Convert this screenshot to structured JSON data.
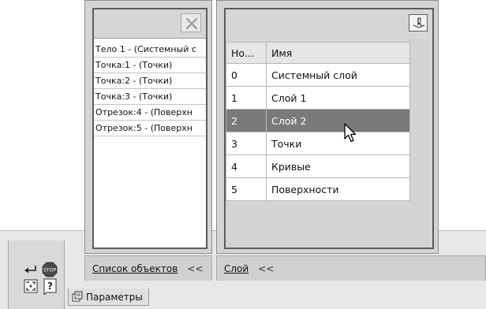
{
  "objects_panel": {
    "items": [
      "Тело 1 - (Системный с",
      "Точка:1 - (Точки)",
      "Точка:2 - (Точки)",
      "Точка:3 - (Точки)",
      "Отрезок:4 - (Поверхн",
      "Отрезок:5 - (Поверхн"
    ],
    "tab_label": "Список объектов",
    "collapse": "<<"
  },
  "layers_panel": {
    "columns": [
      "Но...",
      "Имя"
    ],
    "rows": [
      {
        "num": "0",
        "name": "Системный слой"
      },
      {
        "num": "1",
        "name": "Слой 1"
      },
      {
        "num": "2",
        "name": "Слой 2"
      },
      {
        "num": "3",
        "name": "Точки"
      },
      {
        "num": "4",
        "name": "Кривые"
      },
      {
        "num": "5",
        "name": "Поверхности"
      }
    ],
    "selected_index": 2,
    "tab_label": "Слой",
    "collapse": "<<"
  },
  "bottom": {
    "params_tab_label": "Параметры",
    "stop_label": "STOP",
    "help_label": "?"
  },
  "icons": {
    "delete": "delete-x-icon",
    "layer_tool": "layer-pointer-icon",
    "enter": "enter-arrow-icon",
    "stop": "stop-icon",
    "fit": "fit-frame-icon",
    "help": "help-question-icon",
    "params": "parameters-icon",
    "cursor": "mouse-cursor-icon"
  }
}
